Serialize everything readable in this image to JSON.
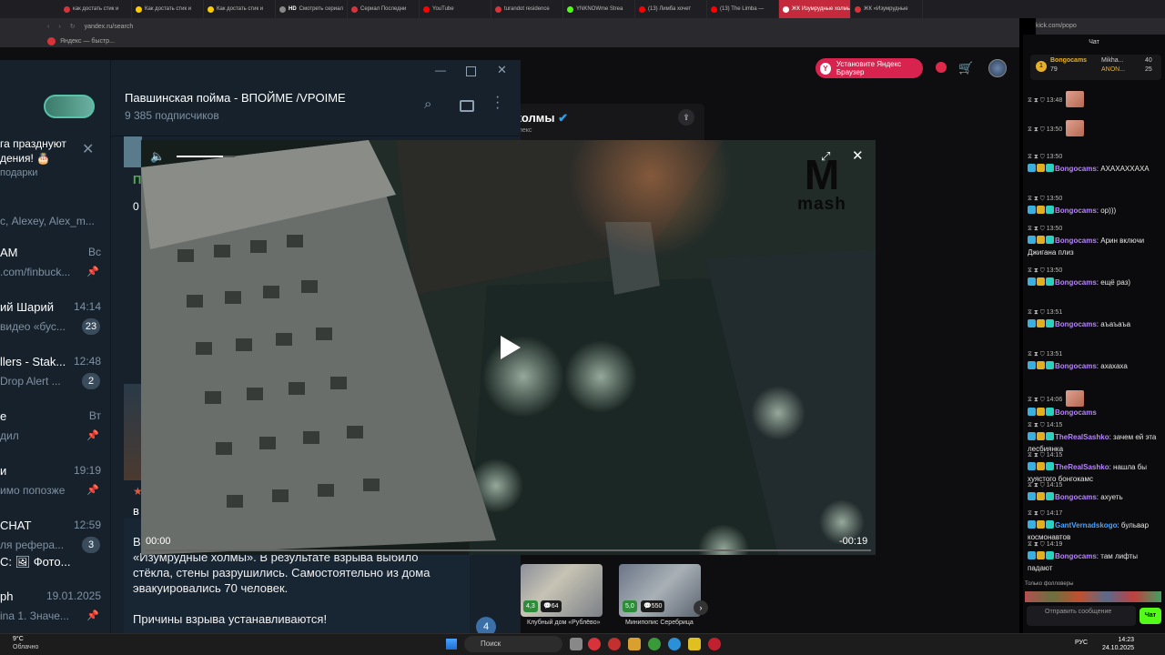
{
  "browser": {
    "tabs": [
      {
        "title": "как достать стик и",
        "color": "#d8333a"
      },
      {
        "title": "Как достать стик и",
        "color": "#ffcc00"
      },
      {
        "title": "Как достать стик и",
        "color": "#ffcc00"
      },
      {
        "title": "Смотреть сериал",
        "color": "#888888",
        "prefix": "HD"
      },
      {
        "title": "Сериал Последни",
        "color": "#d8333a"
      },
      {
        "title": "YouTube",
        "color": "#ff0000"
      },
      {
        "title": "turandot residence",
        "color": "#d8333a"
      },
      {
        "title": "YNKNOWme Strea",
        "color": "#53fc18"
      },
      {
        "title": "(13) Лимба хочет",
        "color": "#ff0000"
      },
      {
        "title": "(13) The Limba —",
        "color": "#ff0000"
      },
      {
        "title": "ЖК Изумрудные холмы",
        "color": "#ffffff",
        "active": true
      },
      {
        "title": "ЖК «Изумрудные",
        "color": "#d8333a"
      }
    ],
    "url": "yandex.ru/search",
    "bookmark": "Яндекс — быстр...",
    "kick_url": "kick.com/popo"
  },
  "kick": {
    "install_button": "Установите Яндекс Браузер",
    "stream_title": "холмы",
    "stream_sub": "плекс",
    "shop": [
      {
        "label": "Клубный дом «Рублёво»",
        "rating": "4,3",
        "reviews": "64"
      },
      {
        "label": "Минипопис Серебрица",
        "rating": "5,0",
        "reviews": "550"
      }
    ]
  },
  "telegram": {
    "channel_title": "Павшинская пойма - ВПОЙМЕ /VPOIME",
    "subscribers": "9 385 подписчиков",
    "promo_line1": "га празднуют",
    "promo_line2": "дения!",
    "promo_link": "подарки",
    "chats": [
      {
        "name": "с, Alexey, Alex_m...",
        "preview": "",
        "time": "",
        "count": ""
      },
      {
        "name": "AM",
        "preview": ".com/finbuck...",
        "time": "Вс",
        "count": ""
      },
      {
        "name": "ий Шарий",
        "preview": "видео «бус...",
        "time": "14:14",
        "count": "23"
      },
      {
        "name": "llers - Stak...",
        "preview": "Drop Alert ...",
        "time": "12:48",
        "count": "2"
      },
      {
        "name": "е",
        "preview": "дил",
        "time": "Вт",
        "count": ""
      },
      {
        "name": "и",
        "preview": "имо попозже",
        "time": "19:19",
        "count": ""
      },
      {
        "name": "CHAT",
        "preview": "ля рефера...",
        "time": "12:59",
        "count": "3"
      },
      {
        "name": "С: 🖼 Фото...",
        "preview": "",
        "time": "",
        "count": ""
      },
      {
        "name": "ph",
        "preview": "ina  1. Значе...",
        "time": "19.01.2025",
        "count": ""
      }
    ],
    "message_lines": [
      "«Изумрудные холмы». В результате взрыва выбило",
      "стёкла, стены разрушились. Самостоятельно из дома",
      "эвакуировались 70 человек.",
      "",
      "Причины взрыва устанавливаются!"
    ],
    "message_prefix": "В",
    "badge_count": "4"
  },
  "video": {
    "watermark": "mash",
    "time_current": "00:00",
    "time_remaining": "-00:19",
    "volume_level": 0.8
  },
  "chat": {
    "header": "Чат",
    "top": [
      {
        "name": "Bongocams",
        "value": "79"
      },
      {
        "name": "Mikha...",
        "value": "40"
      },
      {
        "name": "ANON...",
        "value": "25"
      }
    ],
    "messages": [
      {
        "time": "13:48",
        "user": "",
        "text": "",
        "emote": true,
        "color": "#b784ff"
      },
      {
        "time": "13:50",
        "user": "",
        "text": "",
        "emote": true,
        "color": "#b784ff"
      },
      {
        "time": "13:50",
        "user": "Bongocams",
        "text": "АХАХАХХАХА",
        "color": "#b784ff"
      },
      {
        "time": "13:50",
        "user": "Bongocams",
        "text": "ор)))",
        "color": "#b784ff"
      },
      {
        "time": "13:50",
        "user": "Bongocams",
        "text": "Арин включи Джигана плиз",
        "color": "#b784ff"
      },
      {
        "time": "13:50",
        "user": "Bongocams",
        "text": "ещё раз)",
        "color": "#b784ff"
      },
      {
        "time": "13:51",
        "user": "Bongocams",
        "text": "аъаъаъа",
        "color": "#b784ff"
      },
      {
        "time": "13:51",
        "user": "Bongocams",
        "text": "ахахаха",
        "color": "#b784ff"
      },
      {
        "time": "14:06",
        "user": "Bongocams",
        "text": "",
        "emote": true,
        "color": "#b784ff"
      },
      {
        "time": "14:15",
        "user": "TheRealSashko",
        "text": "зачем ей эта лесбиянка",
        "color": "#b784ff"
      },
      {
        "time": "14:15",
        "user": "TheRealSashko",
        "text": "нашла бы хуястого бонгокамс",
        "color": "#b784ff"
      },
      {
        "time": "14:15",
        "user": "Bongocams",
        "text": "ахуеть",
        "color": "#b784ff"
      },
      {
        "time": "14:17",
        "user": "GantVernadskogo",
        "text": "бульвар космонавтов",
        "color": "#4aa3ff"
      },
      {
        "time": "14:19",
        "user": "Bongocams",
        "text": "там лифты падают",
        "color": "#b784ff"
      }
    ],
    "followers_only": "Только фолловеры",
    "input_placeholder": "Отправить сообщение",
    "send_button": "Чат"
  },
  "taskbar": {
    "weather_temp": "9°C",
    "weather_desc": "Облачно",
    "search_placeholder": "Поиск",
    "lang": "РУС",
    "time": "14:23",
    "date": "24.10.2025"
  }
}
